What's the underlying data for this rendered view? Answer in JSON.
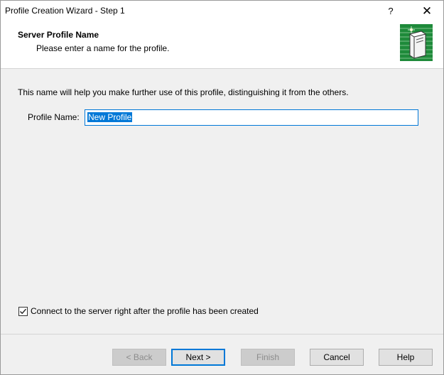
{
  "window": {
    "title": "Profile Creation Wizard - Step 1",
    "help_glyph": "?",
    "close_glyph": "✕"
  },
  "header": {
    "title": "Server Profile Name",
    "subtitle": "Please enter a name for the profile.",
    "icon": "server-wizard-icon"
  },
  "body": {
    "description": "This name will help you make further use of this profile, distinguishing it from the others.",
    "profile_name_label": "Profile Name:",
    "profile_name_value": "New Profile"
  },
  "options": {
    "connect_label": "Connect to the server right after the profile has been created",
    "connect_checked": true
  },
  "buttons": {
    "back": "< Back",
    "next": "Next >",
    "finish": "Finish",
    "cancel": "Cancel",
    "help": "Help"
  },
  "colors": {
    "accent": "#0078d7",
    "icon_green": "#1e8a3a"
  }
}
